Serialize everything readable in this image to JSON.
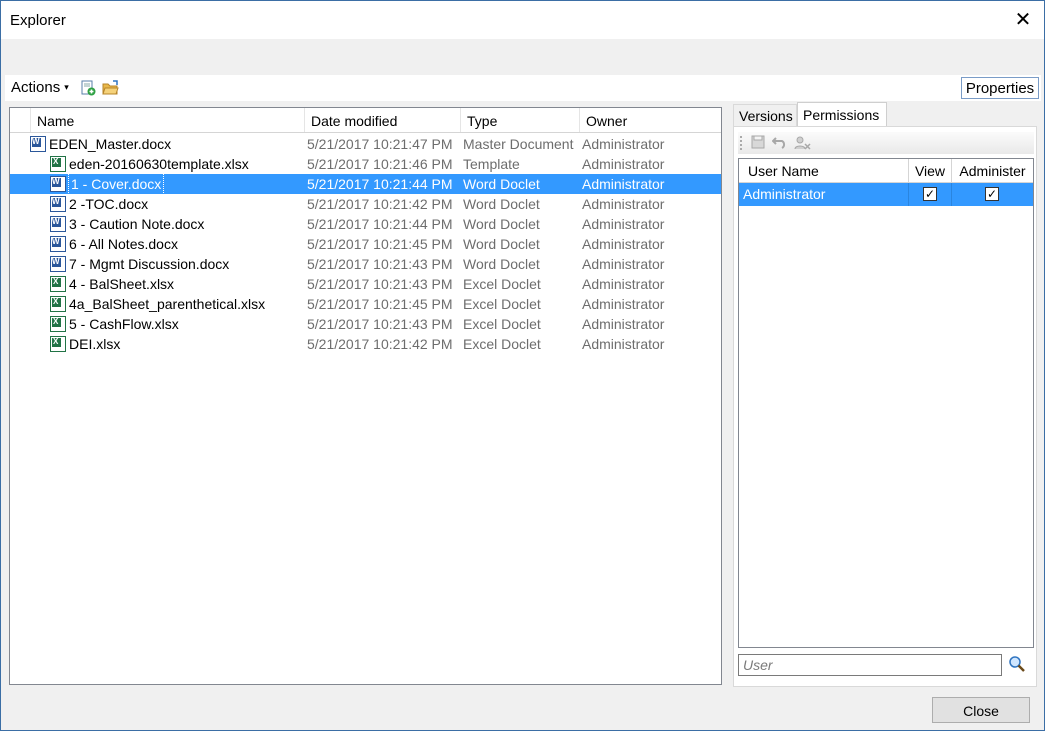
{
  "window": {
    "title": "Explorer",
    "close_glyph": "✕"
  },
  "toolbar": {
    "actions_label": "Actions",
    "actions_caret": "▾",
    "icons": [
      "add-green-document-icon",
      "open-folder-icon"
    ],
    "properties_label": "Properties"
  },
  "tree": {
    "columns": [
      "Name",
      "Date modified",
      "Type",
      "Owner"
    ],
    "rows": [
      {
        "name": "EDEN_Master.docx",
        "date": "5/21/2017 10:21:47 PM",
        "type": "Master Document",
        "owner": "Administrator",
        "icon": "word",
        "level": 0,
        "selected": false
      },
      {
        "name": "eden-20160630template.xlsx",
        "date": "5/21/2017 10:21:46 PM",
        "type": "Template",
        "owner": "Administrator",
        "icon": "template",
        "level": 1,
        "selected": false
      },
      {
        "name": "1 - Cover.docx",
        "date": "5/21/2017 10:21:44 PM",
        "type": "Word Doclet",
        "owner": "Administrator",
        "icon": "word",
        "level": 1,
        "selected": true
      },
      {
        "name": "2 -TOC.docx",
        "date": "5/21/2017 10:21:42 PM",
        "type": "Word Doclet",
        "owner": "Administrator",
        "icon": "word",
        "level": 1,
        "selected": false
      },
      {
        "name": "3 - Caution Note.docx",
        "date": "5/21/2017 10:21:44 PM",
        "type": "Word Doclet",
        "owner": "Administrator",
        "icon": "word",
        "level": 1,
        "selected": false
      },
      {
        "name": "6 - All Notes.docx",
        "date": "5/21/2017 10:21:45 PM",
        "type": "Word Doclet",
        "owner": "Administrator",
        "icon": "word",
        "level": 1,
        "selected": false
      },
      {
        "name": "7 - Mgmt Discussion.docx",
        "date": "5/21/2017 10:21:43 PM",
        "type": "Word Doclet",
        "owner": "Administrator",
        "icon": "word",
        "level": 1,
        "selected": false
      },
      {
        "name": "4 - BalSheet.xlsx",
        "date": "5/21/2017 10:21:43 PM",
        "type": "Excel Doclet",
        "owner": "Administrator",
        "icon": "excel",
        "level": 1,
        "selected": false
      },
      {
        "name": "4a_BalSheet_parenthetical.xlsx",
        "date": "5/21/2017 10:21:45 PM",
        "type": "Excel Doclet",
        "owner": "Administrator",
        "icon": "excel",
        "level": 1,
        "selected": false
      },
      {
        "name": "5 - CashFlow.xlsx",
        "date": "5/21/2017 10:21:43 PM",
        "type": "Excel Doclet",
        "owner": "Administrator",
        "icon": "excel",
        "level": 1,
        "selected": false
      },
      {
        "name": "DEI.xlsx",
        "date": "5/21/2017 10:21:42 PM",
        "type": "Excel Doclet",
        "owner": "Administrator",
        "icon": "excel",
        "level": 1,
        "selected": false
      }
    ]
  },
  "side": {
    "tabs": [
      "Versions",
      "Permissions"
    ],
    "active_tab": "Permissions",
    "perm_toolbar_icons": [
      "save-icon",
      "undo-icon",
      "remove-user-icon"
    ],
    "grid_columns": [
      "User Name",
      "View",
      "Administer"
    ],
    "grid_rows": [
      {
        "user": "Administrator",
        "view": true,
        "administer": true
      }
    ],
    "user_placeholder": "User",
    "checkmark": "✓"
  },
  "footer": {
    "close_label": "Close"
  },
  "colors": {
    "selection": "#3399ff",
    "window_bg": "#f0f0f0",
    "word_icon": "#2b579a",
    "excel_icon": "#217346"
  }
}
